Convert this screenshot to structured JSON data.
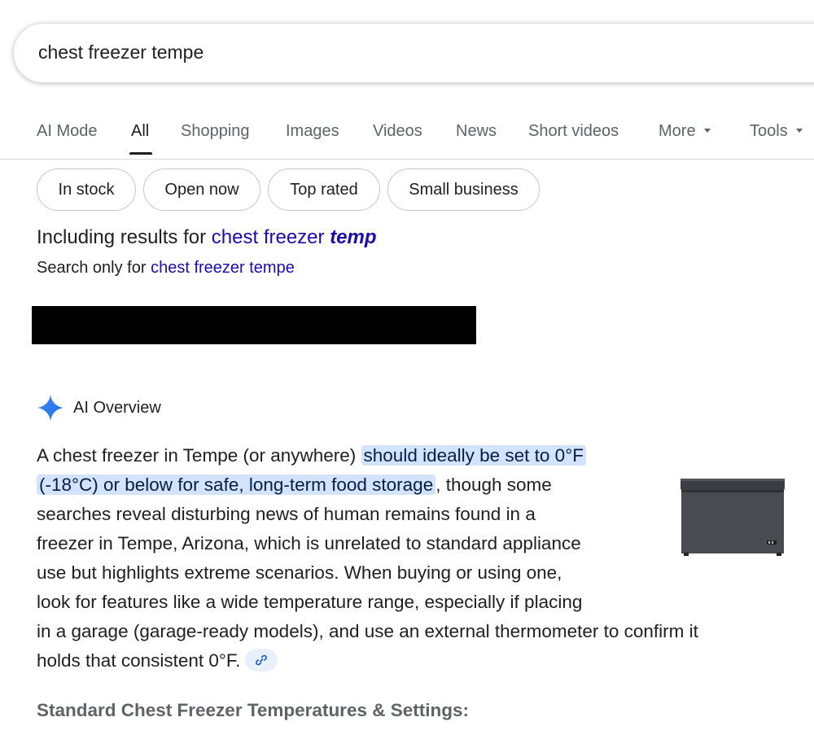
{
  "search": {
    "query": "chest freezer tempe"
  },
  "tabs": [
    {
      "label": "AI Mode"
    },
    {
      "label": "All"
    },
    {
      "label": "Shopping"
    },
    {
      "label": "Images"
    },
    {
      "label": "Videos"
    },
    {
      "label": "News"
    },
    {
      "label": "Short videos"
    },
    {
      "label": "More"
    },
    {
      "label": "Tools"
    }
  ],
  "chips": [
    {
      "label": "In stock"
    },
    {
      "label": "Open now"
    },
    {
      "label": "Top rated"
    },
    {
      "label": "Small business"
    }
  ],
  "spelling": {
    "including_prefix": "Including results for ",
    "corrected_main": "chest freezer ",
    "corrected_emph": "temp",
    "search_only_prefix": "Search only for ",
    "original_query": "chest freezer tempe"
  },
  "ai_overview": {
    "title": "AI Overview",
    "lines": [
      {
        "pre": "A chest freezer in Tempe (or anywhere) ",
        "hl": "should ideally be set to 0°F"
      },
      {
        "hl": "(-18°C) or below for safe, long-term food storage",
        "post": ", though some"
      },
      {
        "text": "searches reveal disturbing news of human remains found in a"
      },
      {
        "text": "freezer in Tempe, Arizona, which is unrelated to standard appliance"
      },
      {
        "text": "use but highlights extreme scenarios. When buying or using one,"
      },
      {
        "text": "look for features like a wide temperature range, especially if placing"
      },
      {
        "text": "in a garage (garage-ready models), and use an external thermometer to confirm it"
      },
      {
        "text": "holds that consistent 0°F."
      }
    ],
    "image_icon": "chest-freezer-image",
    "link_icon": "link-icon",
    "subheading": "Standard Chest Freezer Temperatures & Settings:"
  },
  "colors": {
    "link": "#1a0dab",
    "highlight_bg": "#d3e3fd",
    "highlight_text": "#041e49",
    "sparkle": "#4285f4"
  }
}
